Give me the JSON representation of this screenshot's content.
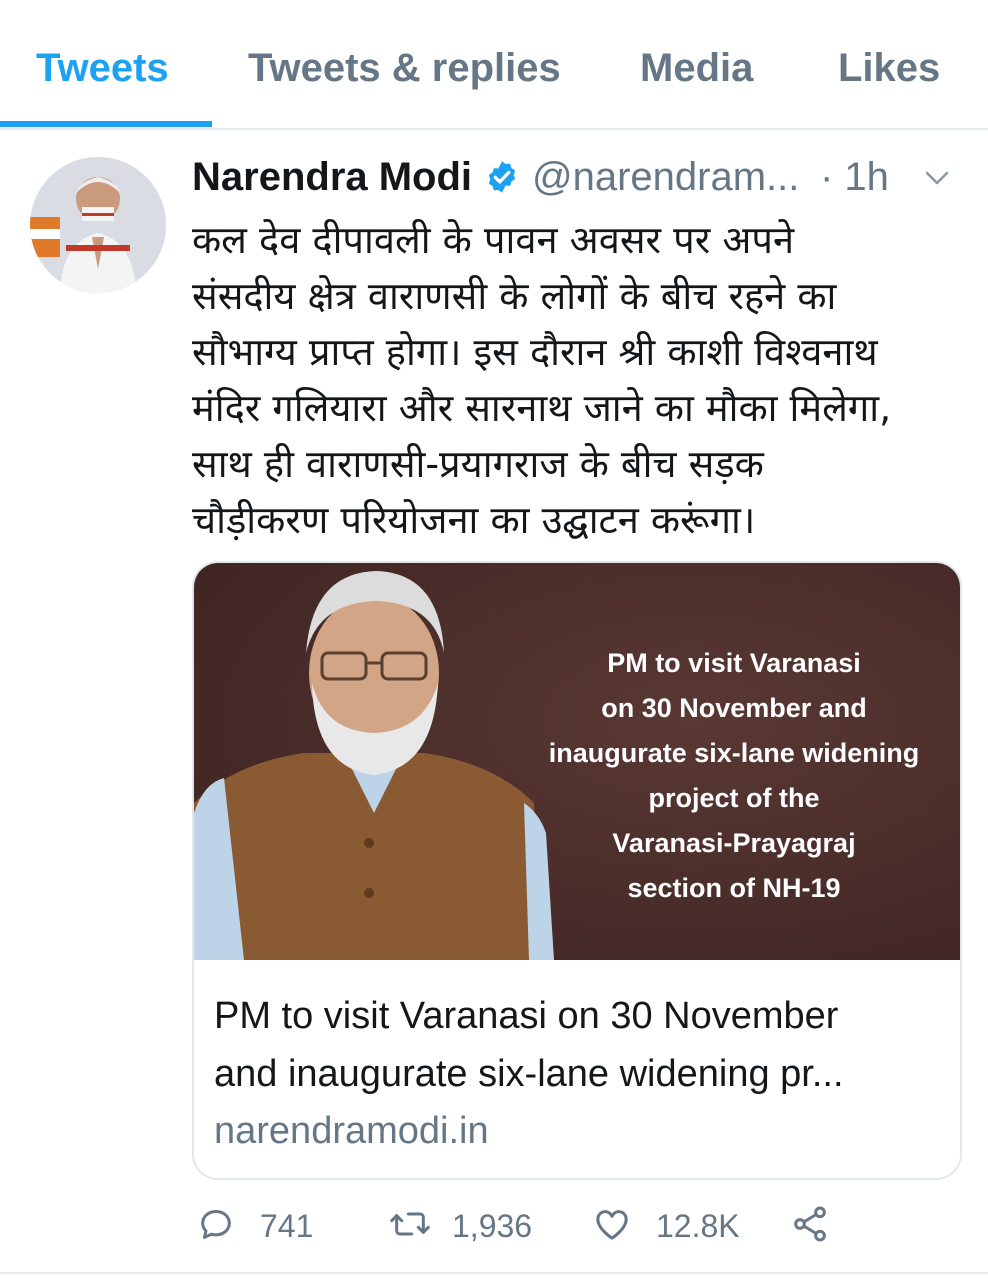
{
  "tabs": [
    {
      "label": "Tweets",
      "active": true
    },
    {
      "label": "Tweets & replies",
      "active": false
    },
    {
      "label": "Media",
      "active": false
    },
    {
      "label": "Likes",
      "active": false
    }
  ],
  "tweet": {
    "author_name": "Narendra Modi",
    "verified": true,
    "handle": "@narendram...",
    "time": "· 1h",
    "text_lines": [
      "कल देव दीपावली के पावन अवसर पर अपने",
      "संसदीय क्षेत्र वाराणसी के लोगों के बीच रहने का",
      "सौभाग्य प्राप्त होगा। इस दौरान श्री काशी विश्वनाथ",
      "मंदिर गलियारा और सारनाथ जाने का मौका मिलेगा,",
      "साथ ही वाराणसी-प्रयागराज के बीच सड़क",
      "चौड़ीकरण परियोजना का उद्घाटन करूंगा।"
    ],
    "card": {
      "image_text_lines": [
        "PM to visit Varanasi",
        "on 30 November and",
        "inaugurate six-lane widening",
        "project of the",
        "Varanasi-Prayagraj",
        "section of NH-19"
      ],
      "title_lines": [
        "PM to visit Varanasi on 30 November",
        "and inaugurate six-lane widening pr..."
      ],
      "domain": "narendramodi.in"
    },
    "actions": {
      "replies": "741",
      "retweets": "1,936",
      "likes": "12.8K"
    }
  },
  "icons": [
    "verified-badge-icon",
    "chevron-down-icon",
    "reply-icon",
    "retweet-icon",
    "like-icon",
    "share-icon"
  ],
  "colors": {
    "accent": "#1da1f2",
    "secondary_text": "#657786",
    "card_bg": "#4a2c28"
  }
}
